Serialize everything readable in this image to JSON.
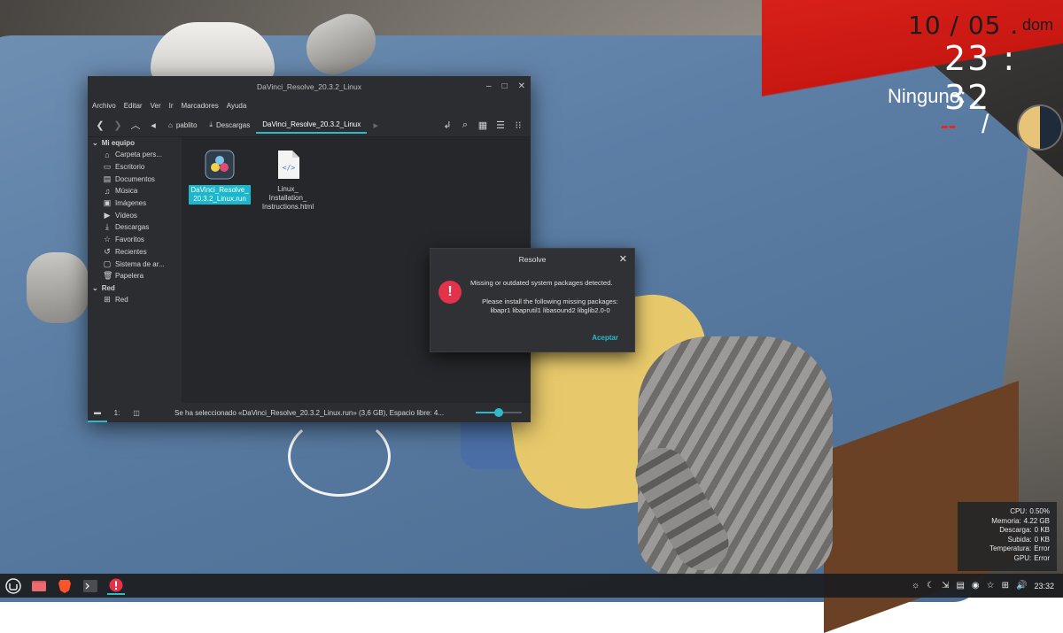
{
  "desktop": {
    "conky": {
      "date": "10 / 05 .",
      "weekday": "dom",
      "time": "23 : 32",
      "weather_location": "Ninguno:",
      "weather_temp": "--",
      "weather_sep": "/"
    },
    "sysmon": [
      {
        "key": "CPU:",
        "value": "0.50%"
      },
      {
        "key": "Memoria:",
        "value": "4.22 GB"
      },
      {
        "key": "Descarga:",
        "value": "0 KB"
      },
      {
        "key": "Subida:",
        "value": "0 KB"
      },
      {
        "key": "Temperatura:",
        "value": "Error"
      },
      {
        "key": "GPU:",
        "value": "Error"
      }
    ]
  },
  "file_manager": {
    "title": "DaVinci_Resolve_20.3.2_Linux",
    "menu": [
      "Archivo",
      "Editar",
      "Ver",
      "Ir",
      "Marcadores",
      "Ayuda"
    ],
    "breadcrumbs": {
      "home": "pablito",
      "downloads": "Descargas",
      "current": "DaVinci_Resolve_20.3.2_Linux"
    },
    "sidebar": {
      "section_computer": "Mi equipo",
      "computer_items": [
        {
          "label": "Carpeta pers...",
          "icon": "home-icon"
        },
        {
          "label": "Escritorio",
          "icon": "desktop-icon"
        },
        {
          "label": "Documentos",
          "icon": "documents-icon"
        },
        {
          "label": "Música",
          "icon": "music-icon"
        },
        {
          "label": "Imágenes",
          "icon": "pictures-icon"
        },
        {
          "label": "Vídeos",
          "icon": "videos-icon"
        },
        {
          "label": "Descargas",
          "icon": "downloads-icon"
        },
        {
          "label": "Favoritos",
          "icon": "star-icon"
        },
        {
          "label": "Recientes",
          "icon": "history-icon"
        },
        {
          "label": "Sistema de ar...",
          "icon": "drive-icon"
        },
        {
          "label": "Papelera",
          "icon": "trash-icon"
        }
      ],
      "section_network": "Red",
      "network_items": [
        {
          "label": "Red",
          "icon": "network-icon"
        }
      ]
    },
    "files": [
      {
        "name_line1": "DaVinci_Resolve_",
        "name_line2": "20.3.2_Linux.run",
        "selected": true
      },
      {
        "name_line1": "Linux_",
        "name_line2": "Installation_",
        "name_line3": "Instructions.html",
        "selected": false
      }
    ],
    "status_text": "Se ha seleccionado «DaVinci_Resolve_20.3.2_Linux.run» (3,6 GB), Espacio libre: 4...",
    "zoom_level": 0.5
  },
  "dialog": {
    "title": "Resolve",
    "message": "Missing or outdated system packages detected.",
    "detail_line1": "Please install the following missing packages:",
    "detail_line2": "libapr1 libaprutil1 libasound2 libglib2.0-0",
    "ok_label": "Aceptar"
  },
  "taskbar": {
    "clock": "23:32"
  },
  "colors": {
    "accent": "#2fb9c9",
    "error": "#e4324a",
    "conky_red": "#d8201a"
  }
}
